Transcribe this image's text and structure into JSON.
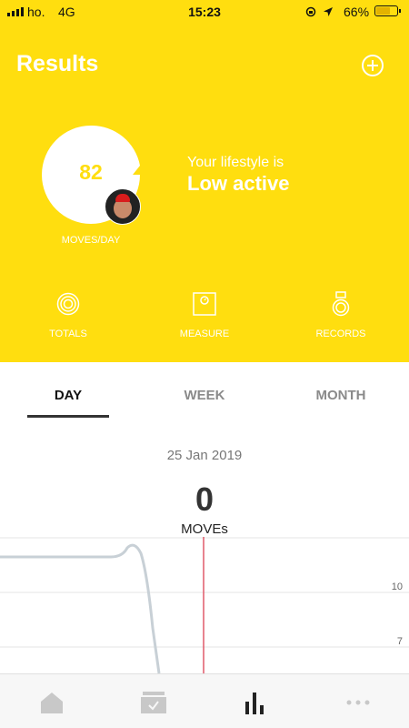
{
  "status_bar": {
    "carrier": "ho.",
    "network": "4G",
    "time": "15:23",
    "battery_pct": "66%",
    "battery_level": 0.66,
    "battery_color": "#E3B300"
  },
  "header": {
    "title": "Results",
    "add_icon": "plus-circle-icon"
  },
  "summary": {
    "score": "82",
    "score_label": "MOVES/DAY",
    "lifestyle_prefix": "Your lifestyle is",
    "lifestyle_level": "Low active"
  },
  "quick_actions": [
    {
      "label": "TOTALS",
      "icon": "totals-rings-icon"
    },
    {
      "label": "MEASURE",
      "icon": "scale-icon"
    },
    {
      "label": "RECORDS",
      "icon": "medal-icon"
    }
  ],
  "tabs": [
    {
      "label": "DAY",
      "active": true
    },
    {
      "label": "WEEK",
      "active": false
    },
    {
      "label": "MONTH",
      "active": false
    }
  ],
  "day_view": {
    "date": "25 Jan 2019",
    "moves": "0",
    "moves_label": "MOVEs"
  },
  "chart_data": {
    "type": "line",
    "y_tick_labels": [
      "10",
      "7"
    ],
    "marker_color": "#E05A6A",
    "line_color": "#C8D0D6"
  },
  "bottom_nav": [
    {
      "name": "home",
      "icon": "home-icon"
    },
    {
      "name": "timeline",
      "icon": "inbox-check-icon"
    },
    {
      "name": "results",
      "icon": "bar-chart-icon",
      "active": true
    },
    {
      "name": "more",
      "icon": "more-dots-icon"
    }
  ],
  "colors": {
    "accent": "#FFDE0F",
    "white": "#FFFFFF",
    "active_text": "#111111",
    "inactive_text": "#8A8A8A"
  }
}
